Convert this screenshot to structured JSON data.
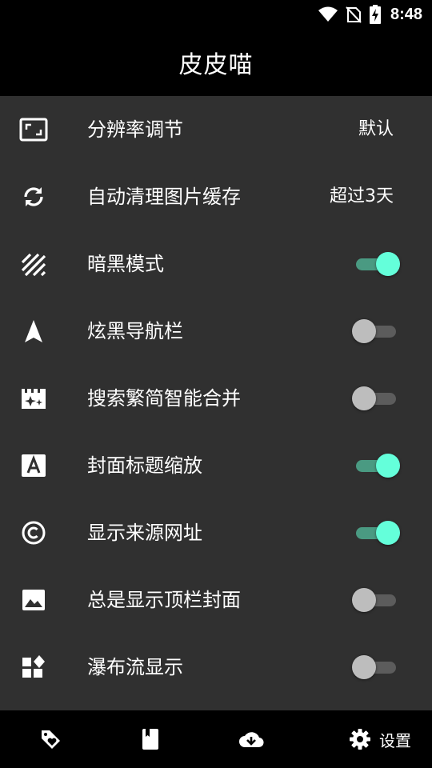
{
  "status_bar": {
    "time": "8:48"
  },
  "app_bar": {
    "title": "皮皮喵"
  },
  "settings": [
    {
      "label": "分辨率调节",
      "value": "默认"
    },
    {
      "label": "自动清理图片缓存",
      "value": "超过3天"
    },
    {
      "label": "暗黑模式",
      "enabled": true
    },
    {
      "label": "炫黑导航栏",
      "enabled": false
    },
    {
      "label": "搜索繁简智能合并",
      "enabled": false
    },
    {
      "label": "封面标题缩放",
      "enabled": true
    },
    {
      "label": "显示来源网址",
      "enabled": true
    },
    {
      "label": "总是显示顶栏封面",
      "enabled": false
    },
    {
      "label": "瀑布流显示",
      "enabled": false
    }
  ],
  "bottom_nav": {
    "items": [
      {
        "icon": "tag-heart-icon"
      },
      {
        "icon": "book-icon"
      },
      {
        "icon": "cloud-download-icon"
      },
      {
        "icon": "gear-icon",
        "label": "设置"
      }
    ]
  },
  "colors": {
    "accent": "#64ffda",
    "accent_track": "#4a9a82",
    "background": "#303030",
    "bar": "#000000"
  }
}
